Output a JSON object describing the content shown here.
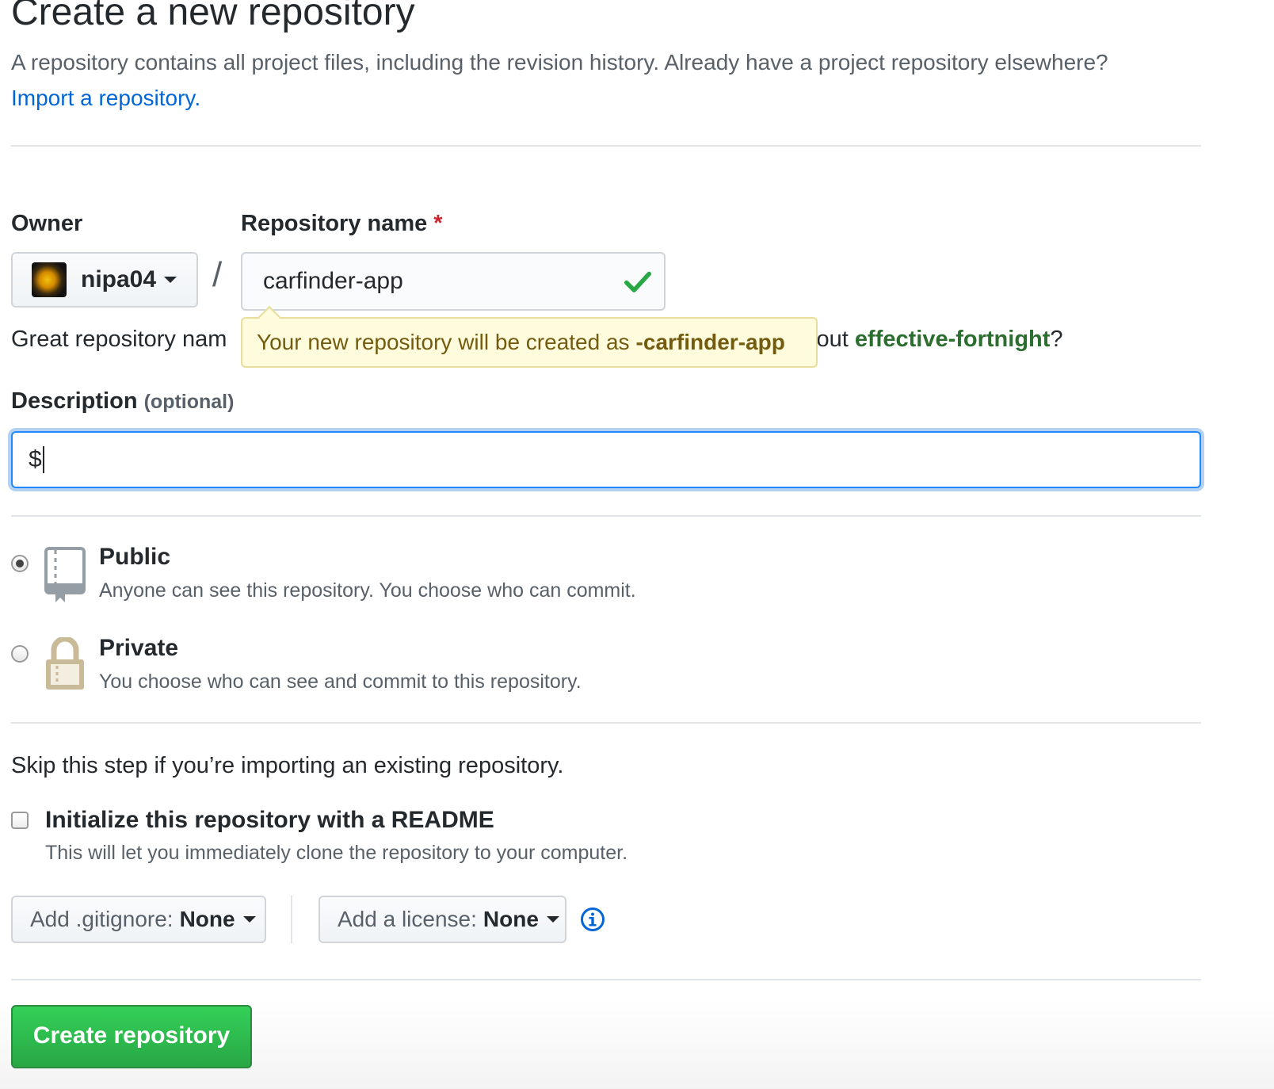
{
  "header": {
    "title": "Create a new repository",
    "subtitle_text": "A repository contains all project files, including the revision history. Already have a project repository elsewhere?",
    "import_link": "Import a repository."
  },
  "form": {
    "owner_label": "Owner",
    "owner_value": "nipa04",
    "slash": "/",
    "repo_name_label": "Repository name",
    "required_mark": "*",
    "repo_name_value": "carfinder-app",
    "tooltip_prefix": "Your new repository will be created as",
    "tooltip_name": "-carfinder-app",
    "suggestion_prefix": "Great repository nam",
    "suggestion_middle": "bout",
    "suggestion_name": "effective-fortnight",
    "suggestion_suffix": "?",
    "description_label": "Description",
    "description_optional": "(optional)",
    "description_value": "$"
  },
  "visibility": {
    "public": {
      "title": "Public",
      "note": "Anyone can see this repository. You choose who can commit.",
      "checked": true,
      "icon": "repo-book-icon"
    },
    "private": {
      "title": "Private",
      "note": "You choose who can see and commit to this repository.",
      "checked": false,
      "icon": "lock-icon"
    }
  },
  "init": {
    "skip_text": "Skip this step if you’re importing an existing repository.",
    "readme_label": "Initialize this repository with a README",
    "readme_note": "This will let you immediately clone the repository to your computer.",
    "readme_checked": false
  },
  "extras": {
    "gitignore_label": "Add .gitignore:",
    "gitignore_value": "None",
    "license_label": "Add a license:",
    "license_value": "None"
  },
  "actions": {
    "create_label": "Create repository"
  },
  "colors": {
    "link": "#0366d6",
    "primary_button": "#28a745",
    "tooltip_bg": "#fffbdd",
    "focus_border": "#2188ff"
  }
}
